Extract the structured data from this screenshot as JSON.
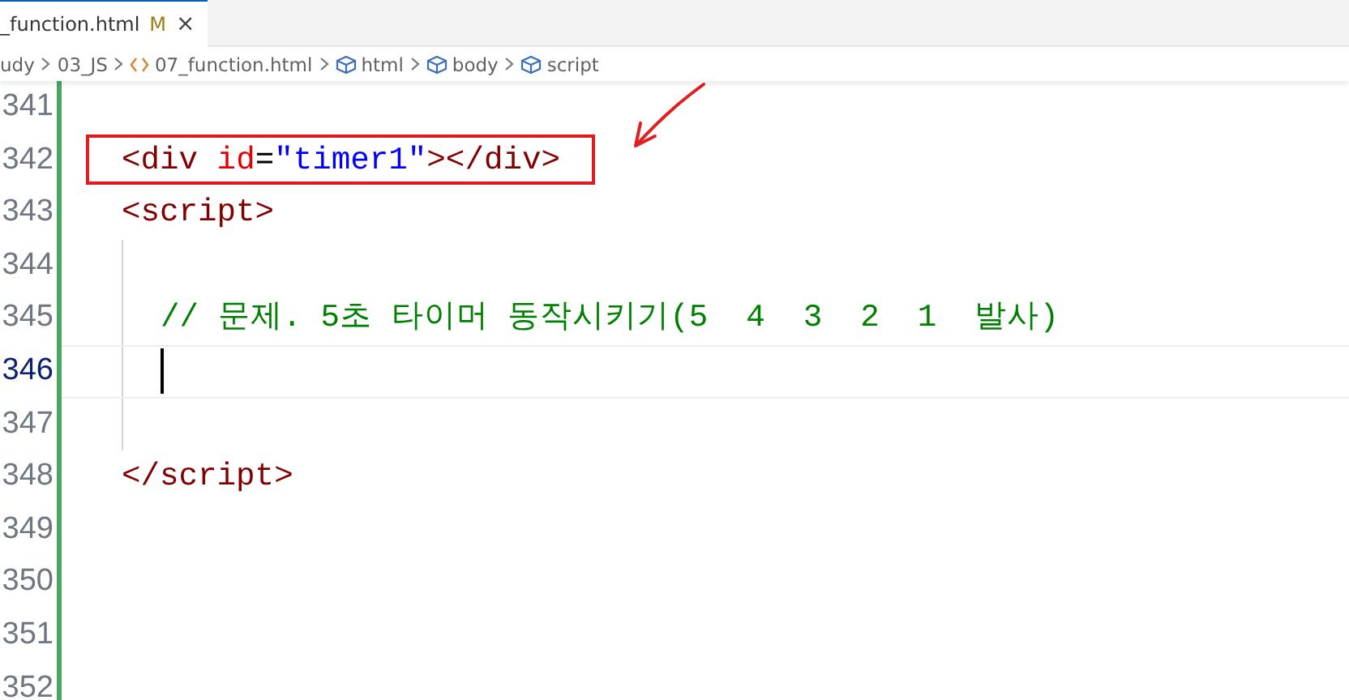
{
  "tab": {
    "title": "_function.html",
    "status": "M",
    "close": "×",
    "selected": true
  },
  "breadcrumb": [
    {
      "kind": "folder",
      "text": "udy"
    },
    {
      "kind": "folder",
      "text": "03_JS"
    },
    {
      "kind": "file",
      "text": "07_function.html"
    },
    {
      "kind": "element",
      "text": "html"
    },
    {
      "kind": "element",
      "text": "body"
    },
    {
      "kind": "element",
      "text": "script"
    }
  ],
  "lines": [
    {
      "number": "341",
      "kind": "markup",
      "current": false,
      "highlighted": false
    },
    {
      "number": "342",
      "kind": "markup",
      "current": false,
      "highlighted": true,
      "tokens": [
        {
          "kind": "tag",
          "text": "<div"
        },
        {
          "kind": "attr",
          "text": " id"
        },
        {
          "kind": "punct",
          "text": "="
        },
        {
          "kind": "string",
          "text": "\"timer1\""
        },
        {
          "kind": "tag",
          "text": "></div>"
        }
      ]
    },
    {
      "number": "343",
      "kind": "markup",
      "current": false,
      "highlighted": false,
      "tokens": [
        {
          "kind": "tag",
          "text": "<script>"
        }
      ]
    },
    {
      "number": "344",
      "kind": "script",
      "current": false,
      "highlighted": false
    },
    {
      "number": "345",
      "kind": "script",
      "current": false,
      "highlighted": false,
      "tokens": [
        {
          "kind": "comment",
          "text": "// 문제. 5초 타이머 동작시키기(5  4  3  2  1  발사)"
        }
      ]
    },
    {
      "number": "346",
      "kind": "script",
      "current": true,
      "highlighted": false
    },
    {
      "number": "347",
      "kind": "script",
      "current": false,
      "highlighted": false
    },
    {
      "number": "348",
      "kind": "markup",
      "current": false,
      "highlighted": false,
      "tokens": [
        {
          "kind": "tag",
          "text": "</script>"
        }
      ]
    },
    {
      "number": "349",
      "kind": "markup",
      "current": false,
      "highlighted": false
    },
    {
      "number": "350",
      "kind": "markup",
      "current": false,
      "highlighted": false
    },
    {
      "number": "351",
      "kind": "markup",
      "current": false,
      "highlighted": false
    },
    {
      "number": "352",
      "kind": "markup",
      "current": false,
      "highlighted": false
    }
  ]
}
